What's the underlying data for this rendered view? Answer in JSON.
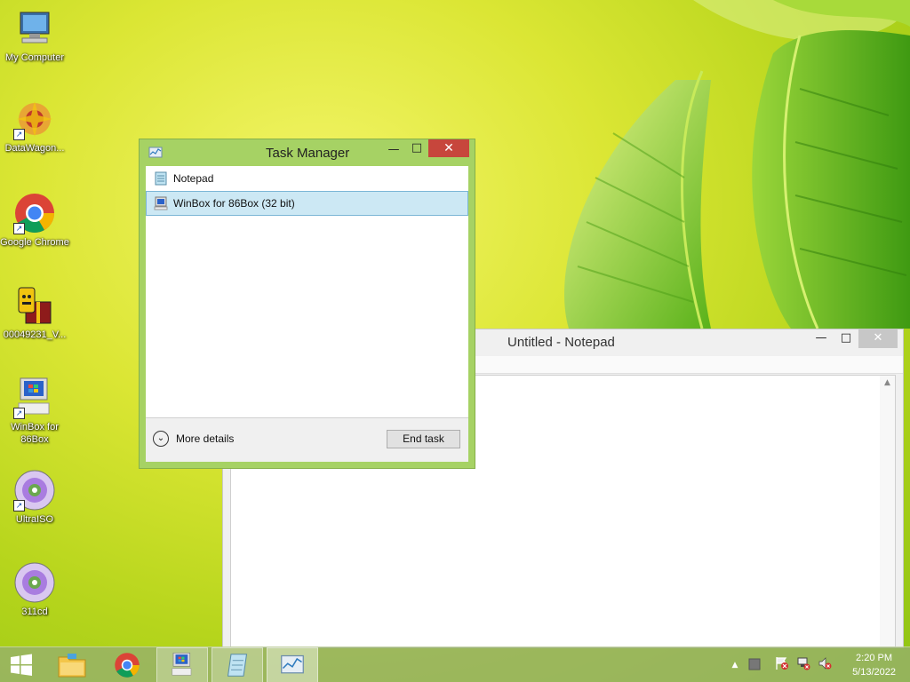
{
  "desktop": {
    "icons": [
      {
        "label": "My Computer",
        "icon": "computer-icon"
      },
      {
        "label": "DataWagon...",
        "icon": "datawagon-icon"
      },
      {
        "label": "Google Chrome",
        "icon": "chrome-icon"
      },
      {
        "label": "00049231_V...",
        "icon": "archive-icon"
      },
      {
        "label": "WinBox for 86Box",
        "icon": "winbox-icon"
      },
      {
        "label": "UltraISO",
        "icon": "disc-icon"
      },
      {
        "label": "311cd",
        "icon": "disc-icon"
      }
    ]
  },
  "notepad": {
    "title": "Untitled - Notepad",
    "minimize": "—",
    "maximize": "□",
    "close": "✕"
  },
  "task_manager": {
    "title": "Task Manager",
    "minimize": "—",
    "maximize": "□",
    "close": "✕",
    "apps": [
      {
        "name": "Notepad",
        "icon": "notepad-icon",
        "selected": false
      },
      {
        "name": "WinBox for 86Box (32 bit)",
        "icon": "winbox-icon",
        "selected": true
      }
    ],
    "more_details": "More details",
    "end_task": "End task"
  },
  "taskbar": {
    "buttons": [
      "start-icon",
      "file-explorer-icon",
      "chrome-icon",
      "winbox-icon",
      "notepad-icon",
      "task-manager-icon"
    ],
    "tray_chevron": "▲",
    "clock_time": "2:20 PM",
    "clock_date": "5/13/2022"
  }
}
